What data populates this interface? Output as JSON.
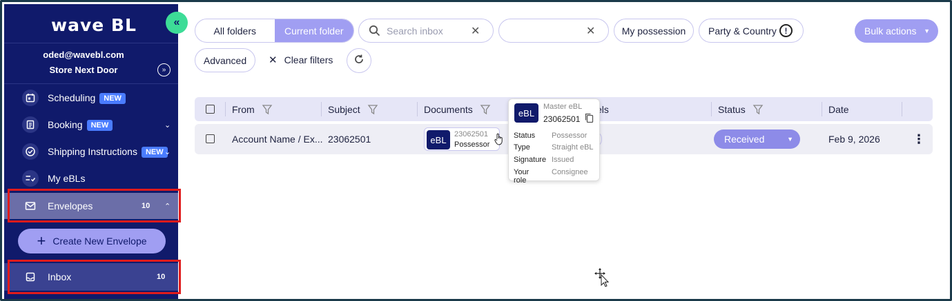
{
  "sidebar": {
    "logo": "wave BL",
    "collapse_icon": "«",
    "account": {
      "email": "oded@wavebl.com",
      "company": "Store Next Door"
    },
    "items": [
      {
        "label": "Scheduling",
        "badge": "NEW",
        "icon": "calendar-icon"
      },
      {
        "label": "Booking",
        "badge": "NEW",
        "icon": "document-icon"
      },
      {
        "label": "Shipping Instructions",
        "badge": "NEW",
        "icon": "check-circle-icon"
      },
      {
        "label": "My eBLs",
        "icon": "list-check-icon"
      },
      {
        "label": "Envelopes",
        "count": "10",
        "icon": "envelope-icon"
      },
      {
        "label": "Inbox",
        "count": "10",
        "icon": "inbox-icon"
      }
    ],
    "create_label": "Create New Envelope"
  },
  "toolbar": {
    "all_folders": "All folders",
    "current_folder": "Current folder",
    "search_placeholder": "Search inbox",
    "second_input_value": "",
    "my_possession": "My possession",
    "party_country": "Party & Country",
    "bulk_actions": "Bulk actions",
    "advanced": "Advanced",
    "clear_filters": "Clear filters"
  },
  "table": {
    "headers": {
      "from": "From",
      "subject": "Subject",
      "documents": "Documents",
      "labels": "els",
      "status": "Status",
      "date": "Date"
    },
    "rows": [
      {
        "from": "Account Name / Ex...",
        "subject": "23062501",
        "doc_type": "eBL",
        "doc_number": "23062501",
        "doc_role": "Possessor",
        "status": "Received",
        "date": "Feb 9, 2026"
      }
    ]
  },
  "popover": {
    "type_label": "eBL",
    "title": "Master eBL",
    "number": "23062501",
    "fields": [
      {
        "key": "Status",
        "value": "Possessor"
      },
      {
        "key": "Type",
        "value": "Straight eBL"
      },
      {
        "key": "Signature",
        "value": "Issued"
      },
      {
        "key": "Your role",
        "value": "Consignee"
      }
    ]
  },
  "colors": {
    "sidebar_bg": "#101a6b",
    "accent": "#a09ef2",
    "collapse_button": "#3ddc97",
    "new_badge": "#4a7cff",
    "highlight_box": "#e01b1b"
  }
}
